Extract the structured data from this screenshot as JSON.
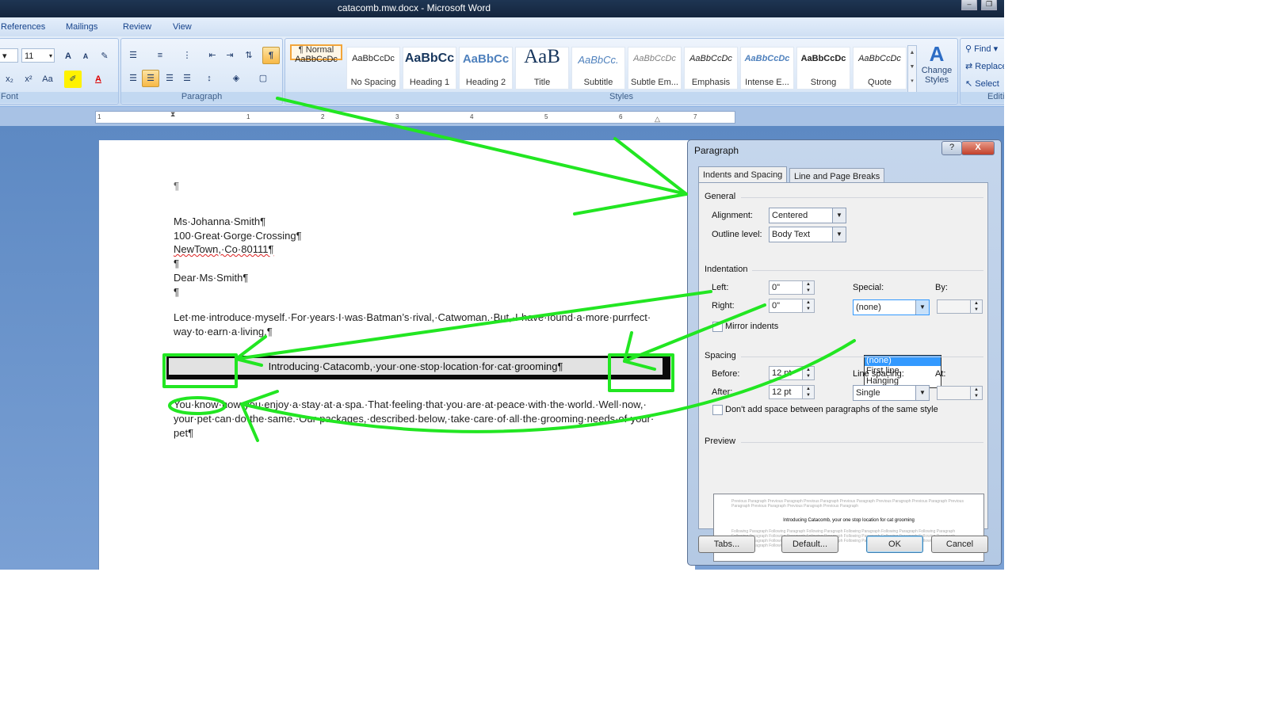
{
  "window": {
    "title": "catacomb.mw.docx - Microsoft Word",
    "controls": [
      "minimize-icon",
      "restore-icon"
    ]
  },
  "ribbon_tabs": [
    "References",
    "Mailings",
    "Review",
    "View"
  ],
  "font_group": {
    "size": "11",
    "label": "Font",
    "buttons": [
      "grow-font-icon",
      "shrink-font-icon",
      "clear-format-icon",
      "subscript-icon",
      "superscript-icon",
      "change-case-icon",
      "highlight-icon",
      "font-color-icon"
    ],
    "glyphs": {
      "grow": "A",
      "shrink": "A",
      "sub": "x₂",
      "sup": "x²",
      "case": "Aa",
      "font_color": "A"
    }
  },
  "paragraph_group": {
    "label": "Paragraph",
    "buttons": [
      "bullets-icon",
      "numbering-icon",
      "multilevel-icon",
      "decrease-indent-icon",
      "increase-indent-icon",
      "sort-icon",
      "show-marks-icon",
      "align-left-icon",
      "center-icon",
      "align-right-icon",
      "justify-icon",
      "line-spacing-icon",
      "shading-icon",
      "borders-icon"
    ],
    "show_marks_glyph": "¶"
  },
  "styles_group": {
    "label": "Styles",
    "items": [
      {
        "preview": "AaBbCcDc",
        "name": "¶ Normal",
        "selected": true
      },
      {
        "preview": "AaBbCcDc",
        "name": "No Spacing"
      },
      {
        "preview": "AaBbCc",
        "name": "Heading 1"
      },
      {
        "preview": "AaBbCc",
        "name": "Heading 2"
      },
      {
        "preview": "AaB",
        "name": "Title"
      },
      {
        "preview": "AaBbCc.",
        "name": "Subtitle"
      },
      {
        "preview": "AaBbCcDc",
        "name": "Subtle Em..."
      },
      {
        "preview": "AaBbCcDc",
        "name": "Emphasis"
      },
      {
        "preview": "AaBbCcDc",
        "name": "Intense E..."
      },
      {
        "preview": "AaBbCcDc",
        "name": "Strong"
      },
      {
        "preview": "AaBbCcDc",
        "name": "Quote"
      }
    ],
    "change_styles": "Change Styles"
  },
  "editing_group": {
    "label": "Editing",
    "find": "Find",
    "replace": "Replace",
    "select": "Select"
  },
  "ruler": {
    "numbers": [
      "1",
      "1",
      "2",
      "3",
      "4",
      "5",
      "6",
      "7"
    ]
  },
  "document": {
    "lines": [
      "¶",
      "Ms·Johanna·Smith¶",
      "100·Great·Gorge·Crossing¶",
      "NewTown,·Co·80111¶",
      "¶",
      "Dear·Ms·Smith¶",
      "¶",
      "Let·me·introduce·myself.·For·years·I·was·Batman’s·rival,·Catwoman.·But,·I·have·found·a·more·purrfect·",
      "way·to·earn·a·living.¶",
      "You·know·how·you·enjoy·a·stay·at·a·spa.·That·feeling·that·you·are·at·peace·with·the·world.·Well·now,·",
      "your·pet·can·do·the·same.·Our·packages,·described·below,·take·care·of·all·the·grooming·needs·of·your·",
      "pet¶"
    ],
    "banner": "Introducing·Catacomb,·your·one·stop·location·for·cat·grooming¶"
  },
  "dialog": {
    "title": "Paragraph",
    "help": "?",
    "close": "X",
    "tabs": [
      "Indents and Spacing",
      "Line and Page Breaks"
    ],
    "general": {
      "section": "General",
      "alignment_label": "Alignment:",
      "alignment_value": "Centered",
      "outline_label": "Outline level:",
      "outline_value": "Body Text"
    },
    "indentation": {
      "section": "Indentation",
      "left_label": "Left:",
      "left_value": "0\"",
      "right_label": "Right:",
      "right_value": "0\"",
      "special_label": "Special:",
      "special_value": "(none)",
      "by_label": "By:",
      "special_options": [
        "(none)",
        "First line",
        "Hanging"
      ],
      "mirror_label": "Mirror indents"
    },
    "spacing": {
      "section": "Spacing",
      "before_label": "Before:",
      "before_value": "12 pt",
      "after_label": "After:",
      "after_value": "12 pt",
      "line_spacing_label": "Line spacing:",
      "line_spacing_value": "Single",
      "at_label": "At:",
      "no_space_label": "Don't add space between paragraphs of the same style"
    },
    "preview": {
      "section": "Preview",
      "prev_text": "Previous Paragraph Previous Paragraph Previous Paragraph Previous Paragraph Previous Paragraph Previous Paragraph Previous Paragraph Previous Paragraph Previous Paragraph Previous Paragraph",
      "current_text": "Introducing Catacomb, your one stop location for cat grooming",
      "following_text": "Following Paragraph Following Paragraph Following Paragraph Following Paragraph Following Paragraph Following Paragraph Following Paragraph Following Paragraph Following Paragraph Following Paragraph Following Paragraph Following Paragraph Following Paragraph Following Paragraph Following Paragraph Following Paragraph Following Paragraph Following Paragraph Following Paragraph Following Paragraph"
    },
    "buttons": {
      "tabs": "Tabs...",
      "default": "Default...",
      "ok": "OK",
      "cancel": "Cancel"
    }
  },
  "colors": {
    "annotation": "#22e622",
    "title_bar": "#1b2f4c",
    "selected_style": "#f2a53a",
    "highlight": "#3399ff"
  }
}
